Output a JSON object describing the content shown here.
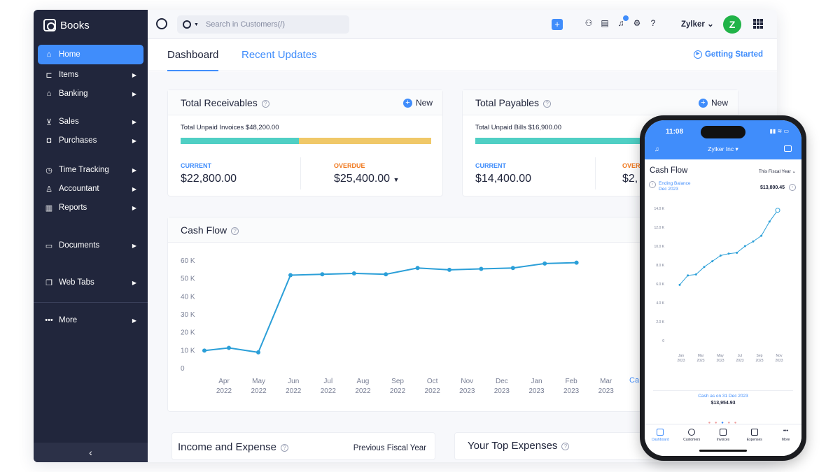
{
  "app": {
    "name": "Books",
    "org": "Zylker",
    "avatar_letter": "Z",
    "accent": "#408dfb",
    "sidebar_bg": "#21263c",
    "current_color": "#4fcfc4",
    "overdue_color": "#f0c868"
  },
  "search": {
    "placeholder": "Search in Customers(/)"
  },
  "sidebar": {
    "items": [
      {
        "label": "Home",
        "icon": "home-icon",
        "active": true
      },
      {
        "label": "Items",
        "icon": "items-icon"
      },
      {
        "label": "Banking",
        "icon": "bank-icon"
      },
      {
        "label": "Sales",
        "icon": "cart-icon"
      },
      {
        "label": "Purchases",
        "icon": "bag-icon"
      },
      {
        "label": "Time Tracking",
        "icon": "clock-icon"
      },
      {
        "label": "Accountant",
        "icon": "accountant-icon"
      },
      {
        "label": "Reports",
        "icon": "reports-icon"
      },
      {
        "label": "Documents",
        "icon": "folder-icon"
      },
      {
        "label": "Web Tabs",
        "icon": "webtabs-icon"
      },
      {
        "label": "More",
        "icon": "more-icon"
      }
    ]
  },
  "tabs": {
    "dashboard": "Dashboard",
    "recent": "Recent Updates",
    "getting_started": "Getting Started"
  },
  "receivables": {
    "title": "Total Receivables",
    "new_label": "New",
    "unpaid": "Total Unpaid Invoices $48,200.00",
    "current_label": "CURRENT",
    "current_value": "$22,800.00",
    "overdue_label": "OVERDUE",
    "overdue_value": "$25,400.00",
    "current_fraction": 0.473
  },
  "payables": {
    "title": "Total Payables",
    "new_label": "New",
    "unpaid": "Total Unpaid Bills $16,900.00",
    "current_label": "CURRENT",
    "current_value": "$14,400.00",
    "overdue_label": "OVER",
    "overdue_value": "$2,"
  },
  "cash_flow": {
    "title": "Cash Flow",
    "cut_text": "Ca"
  },
  "income_expense": {
    "title": "Income and Expense",
    "period": "Previous Fiscal Year"
  },
  "top_expenses": {
    "title": "Your Top Expenses"
  },
  "chart_data": [
    {
      "type": "line",
      "title": "Cash Flow",
      "categories": [
        "Apr 2022",
        "May 2022",
        "Jun 2022",
        "Jul 2022",
        "Aug 2022",
        "Sep 2022",
        "Oct 2022",
        "Nov 2023",
        "Dec 2023",
        "Jan 2023",
        "Feb 2023",
        "Mar 2023"
      ],
      "x_labels_top": [
        "Apr",
        "May",
        "Jun",
        "Jul",
        "Aug",
        "Sep",
        "Oct",
        "Nov",
        "Dec",
        "Jan",
        "Feb",
        "Mar"
      ],
      "x_labels_bottom": [
        "2022",
        "2022",
        "2022",
        "2022",
        "2022",
        "2022",
        "2022",
        "2023",
        "2023",
        "2023",
        "2023",
        "2023"
      ],
      "points_x_index": [
        -0.5,
        0,
        0.5,
        1,
        2,
        3,
        4,
        5,
        6,
        7,
        8,
        9,
        10,
        11
      ],
      "values": [
        10000,
        11500,
        9000,
        52000,
        52500,
        53000,
        52500,
        56000,
        55000,
        55500,
        56000,
        58500,
        59000
      ],
      "y_ticks": [
        "0",
        "10 K",
        "20 K",
        "30 K",
        "40 K",
        "50 K",
        "60 K"
      ],
      "ylim": [
        0,
        60000
      ],
      "color": "#2b9fd8"
    },
    {
      "type": "line",
      "title": "Cash Flow",
      "period": "This Fiscal Year",
      "ending_balance_label": "Ending Balance",
      "ending_balance_period": "Dec 2023",
      "ending_balance": "$13,800.45",
      "x_labels_top": [
        "Jan",
        "Mar",
        "May",
        "Jul",
        "Sep",
        "Nov"
      ],
      "x_labels_bottom": [
        "2023",
        "2023",
        "2023",
        "2023",
        "2023",
        "2023"
      ],
      "values": [
        5900,
        6900,
        7000,
        7800,
        8400,
        9000,
        9200,
        9300,
        10000,
        10500,
        11100,
        12600,
        13800
      ],
      "y_ticks": [
        "0",
        "2.0 K",
        "4.0 K",
        "6.0 K",
        "8.0 K",
        "10.0 K",
        "12.0 K",
        "14.0 K"
      ],
      "ylim": [
        0,
        14000
      ],
      "color": "#2b9fd8"
    }
  ],
  "phone": {
    "time": "11:08",
    "org": "Zylker Inc ▾",
    "cash_as_on": "Cash as on 31 Dec 2023",
    "cash_value": "$13,954.93",
    "nav": [
      "Dashboard",
      "Customers",
      "Invoices",
      "Expenses",
      "More"
    ]
  }
}
